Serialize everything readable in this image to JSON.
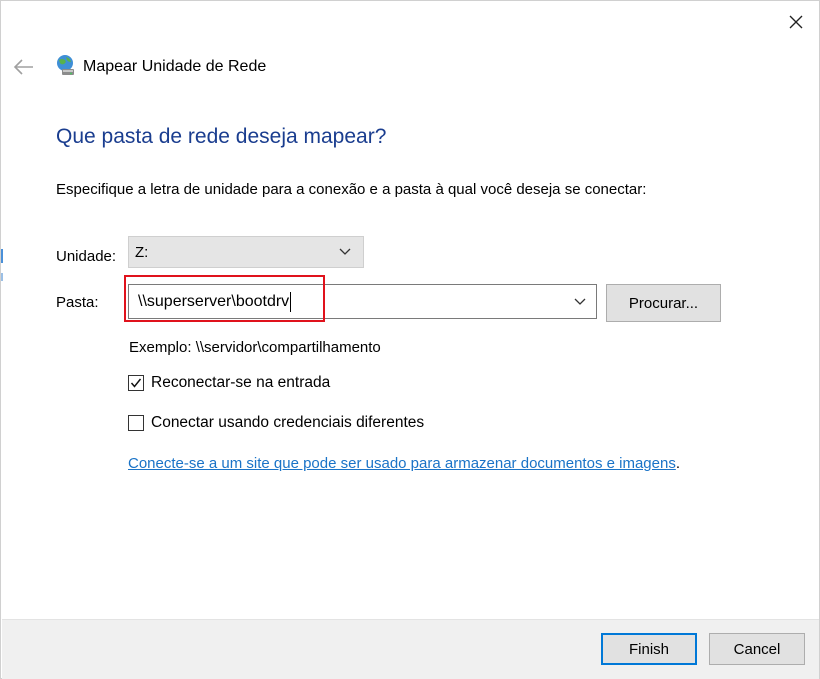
{
  "window": {
    "title": "Mapear Unidade de Rede"
  },
  "icons": {
    "close": "close-icon",
    "back": "back-arrow-icon",
    "wizard": "network-drive-icon"
  },
  "page": {
    "heading": "Que pasta de rede deseja mapear?",
    "instruction": "Especifique a letra de unidade para a conexão e a pasta à qual você deseja se conectar:"
  },
  "drive": {
    "label": "Unidade:",
    "value": "Z:"
  },
  "folder": {
    "label": "Pasta:",
    "value": "\\\\superserver\\bootdrv",
    "browse_label": "Procurar..."
  },
  "example": "Exemplo: \\\\servidor\\compartilhamento",
  "options": {
    "reconnect": {
      "label": "Reconectar-se na entrada",
      "checked": true
    },
    "credentials": {
      "label": "Conectar usando credenciais diferentes",
      "checked": false
    }
  },
  "link": {
    "text": "Conecte-se a um site que pode ser usado para armazenar documentos e imagens",
    "suffix": "."
  },
  "footer": {
    "finish_label": "Finish",
    "cancel_label": "Cancel"
  },
  "colors": {
    "heading": "#1a3d8f",
    "link": "#1a73c7",
    "highlight": "#e0121c",
    "default_button_border": "#0078d7"
  }
}
